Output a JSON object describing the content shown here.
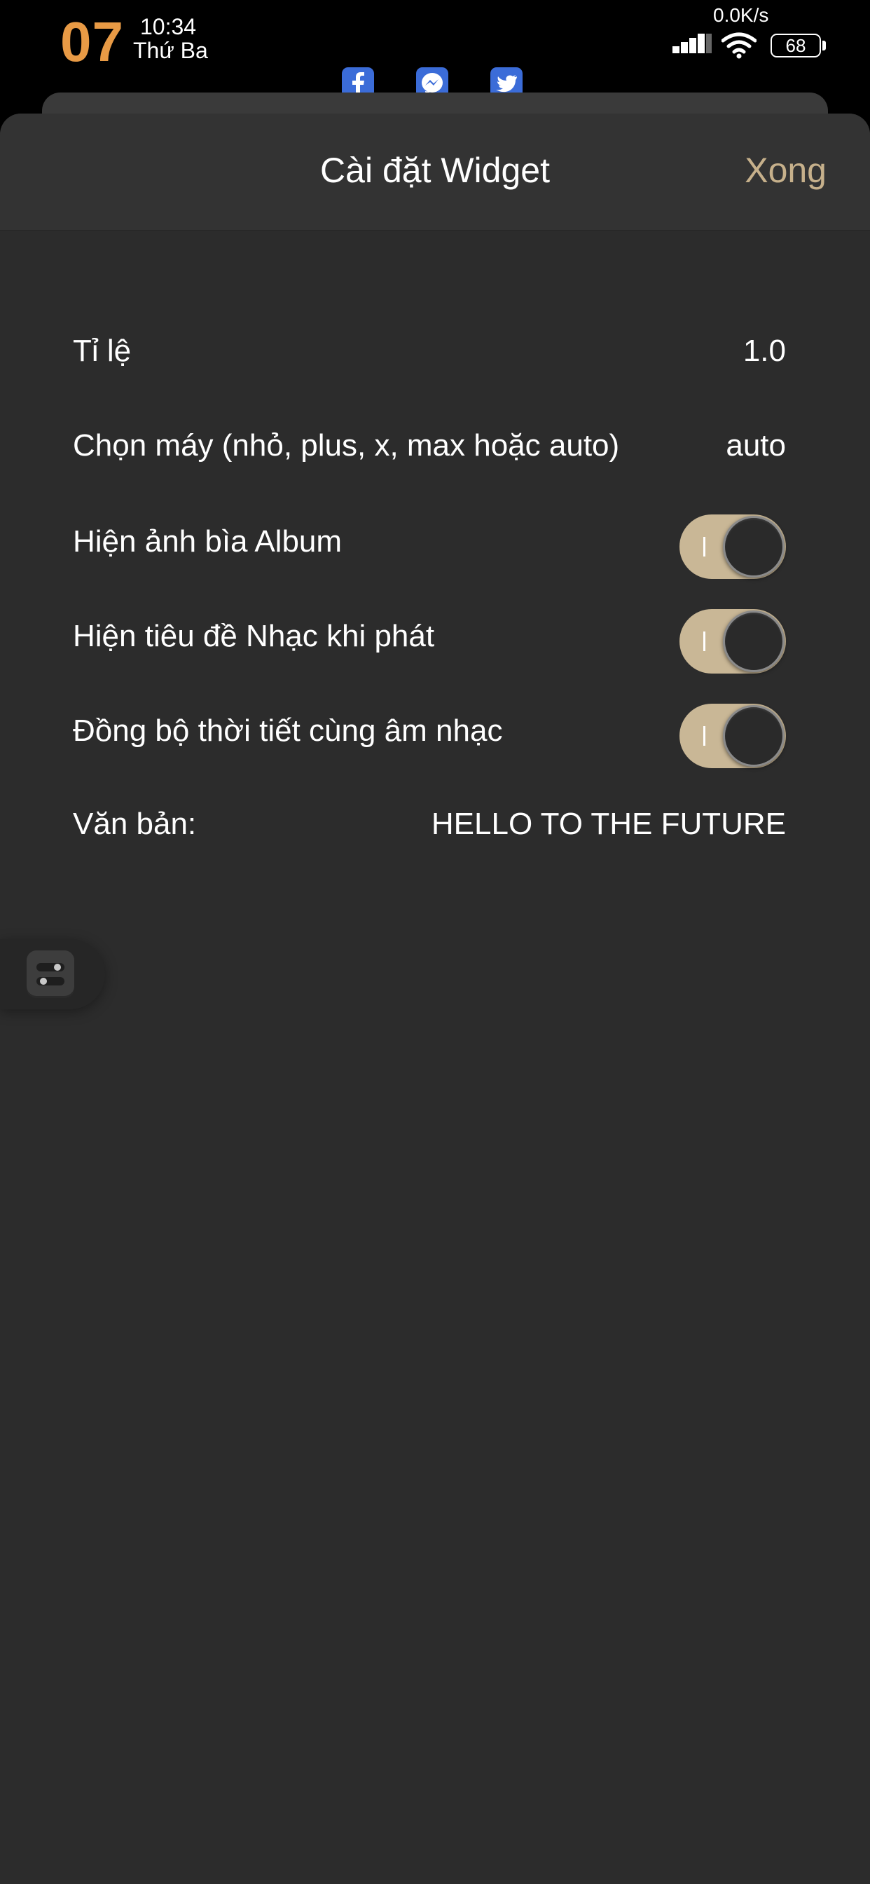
{
  "status_bar": {
    "day": "07",
    "time": "10:34",
    "weekday": "Thứ Ba",
    "network_speed": "0.0K/s",
    "battery": "68",
    "icons": [
      "signal-icon",
      "wifi-icon",
      "battery-icon"
    ]
  },
  "share_icons": [
    "facebook-icon",
    "messenger-icon",
    "twitter-icon"
  ],
  "header": {
    "title": "Cài đặt Widget",
    "done_label": "Xong"
  },
  "settings": {
    "scale": {
      "label": "Tỉ lệ",
      "value": "1.0"
    },
    "device": {
      "label": "Chọn máy (nhỏ, plus, x, max hoặc auto)",
      "value": "auto"
    },
    "album_art": {
      "label": "Hiện ảnh bìa Album",
      "on": true
    },
    "music_title": {
      "label": "Hiện tiêu đề Nhạc khi phát",
      "on": true
    },
    "weather_sync": {
      "label": "Đồng bộ thời tiết cùng âm nhạc",
      "on": true
    },
    "text": {
      "label": "Văn bản:",
      "value": "HELLO TO THE FUTURE"
    }
  },
  "colors": {
    "accent_day": "#e89a45",
    "done_button": "#c6b08b",
    "toggle_track_on": "#c9b796",
    "sheet_background": "#2c2c2c",
    "header_background": "#333333"
  }
}
